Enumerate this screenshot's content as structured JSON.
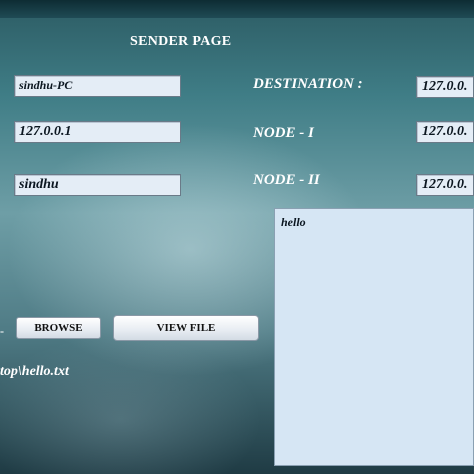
{
  "page": {
    "title": "SENDER PAGE"
  },
  "left_fields": {
    "hostname": "sindhu-PC",
    "ip": "127.0.0.1",
    "user": "sindhu"
  },
  "destinations": [
    {
      "label": "DESTINATION :",
      "value": "127.0.0."
    },
    {
      "label": "NODE - I",
      "value": "127.0.0."
    },
    {
      "label": "NODE - II",
      "value": "127.0.0."
    }
  ],
  "file": {
    "content": "hello",
    "path": "top\\hello.txt",
    "browse_label": "BROWSE",
    "view_label": "VIEW FILE",
    "dash": "-"
  }
}
